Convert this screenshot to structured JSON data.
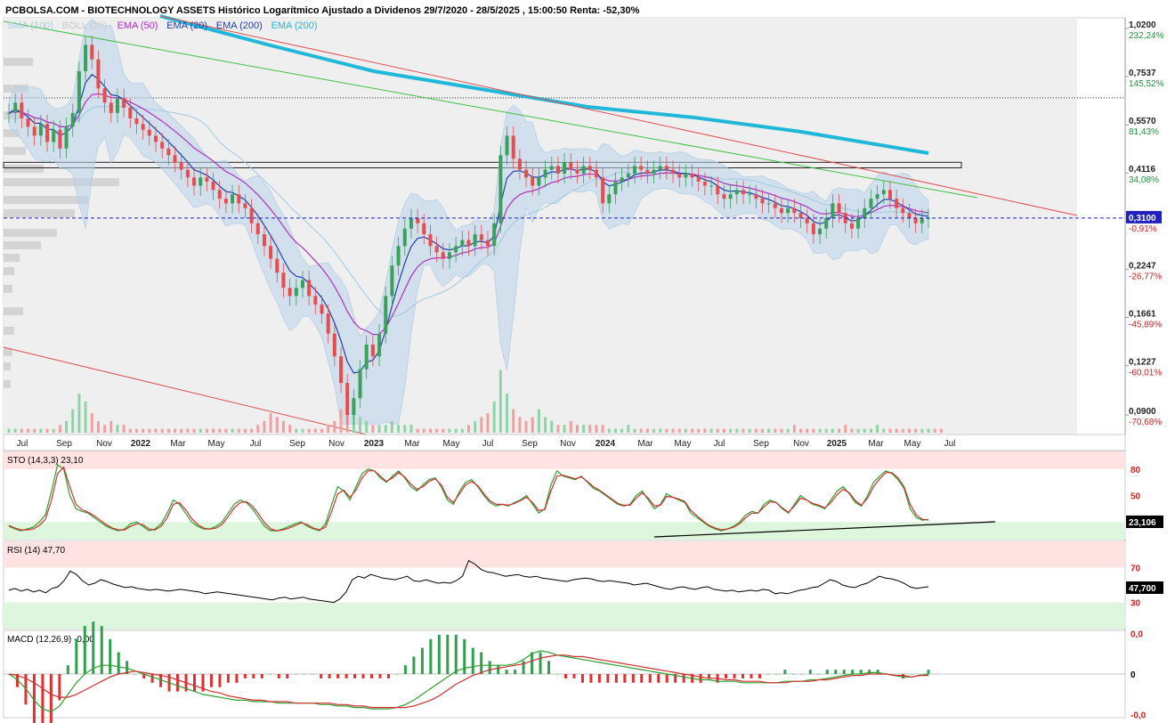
{
  "title": "PCBOLSA.COM - BIOTECHNOLOGY ASSETS Histórico Logarítmico Ajustado a Dividenos 29/7/2020 - 28/5/2025 , 15:00:50 Renta: -52,30%",
  "legend": [
    {
      "label": "SMA (100)",
      "color": "#9ecae1"
    },
    {
      "label": "BOLL (20)",
      "color": "#c8c8c8"
    },
    {
      "label": "EMA (50)",
      "color": "#b030c0"
    },
    {
      "label": "EMA (20)",
      "color": "#2040b0"
    },
    {
      "label": "EMA (200)",
      "color": "#2040b0"
    },
    {
      "label": "EMA (200)",
      "color": "#20b8d8"
    }
  ],
  "colors": {
    "up": "#3aa05a",
    "down": "#e84c4c",
    "band": "#b8d4ea",
    "ema200": "#20b8d8",
    "ema50": "#b030c0",
    "ema20": "#2040b0",
    "sma100": "#9ecae1",
    "trend_red": "#e05050",
    "trend_green": "#40c040",
    "last_price": "#2020c0"
  },
  "chart_data": [
    {
      "type": "line",
      "name": "price",
      "scale": "log",
      "y_ticks": [
        {
          "value": 1.02,
          "label": "1,0200",
          "pct": "232,24%"
        },
        {
          "value": 0.7537,
          "label": "0,7537",
          "pct": "145,52%"
        },
        {
          "value": 0.557,
          "label": "0,5570",
          "pct": "81,43%"
        },
        {
          "value": 0.4116,
          "label": "0,4116",
          "pct": "34,08%"
        },
        {
          "value": 0.31,
          "label": "0,3100",
          "pct": "-0,91%"
        },
        {
          "value": 0.2247,
          "label": "0,2247",
          "pct": "-26,77%"
        },
        {
          "value": 0.1661,
          "label": "0,1661",
          "pct": "-45,89%"
        },
        {
          "value": 0.1227,
          "label": "0,1227",
          "pct": "-60,01%"
        },
        {
          "value": 0.09,
          "label": "0,0900",
          "pct": "-70,68%"
        }
      ],
      "x_ticks": [
        "Jul",
        "Sep",
        "Nov",
        "2022",
        "Mar",
        "May",
        "Jul",
        "Sep",
        "Nov",
        "2023",
        "Mar",
        "May",
        "Jul",
        "Sep",
        "Nov",
        "2024",
        "Mar",
        "May",
        "Jul",
        "Sep",
        "Nov",
        "2025",
        "Mar",
        "May",
        "Jul"
      ],
      "x_tick_years": [
        "2022",
        "2023",
        "2024",
        "2025"
      ],
      "last_price": 0.31,
      "resistance_level": 0.66,
      "range_box": [
        0.425,
        0.44
      ],
      "closes": [
        0.6,
        0.64,
        0.58,
        0.55,
        0.52,
        0.56,
        0.5,
        0.54,
        0.48,
        0.55,
        0.6,
        0.78,
        0.92,
        0.84,
        0.7,
        0.64,
        0.6,
        0.66,
        0.62,
        0.58,
        0.56,
        0.54,
        0.52,
        0.5,
        0.48,
        0.46,
        0.44,
        0.42,
        0.4,
        0.38,
        0.4,
        0.39,
        0.37,
        0.35,
        0.34,
        0.36,
        0.34,
        0.33,
        0.3,
        0.28,
        0.26,
        0.24,
        0.22,
        0.2,
        0.19,
        0.2,
        0.21,
        0.19,
        0.18,
        0.17,
        0.15,
        0.13,
        0.11,
        0.09,
        0.1,
        0.12,
        0.14,
        0.13,
        0.15,
        0.19,
        0.23,
        0.26,
        0.29,
        0.31,
        0.3,
        0.28,
        0.26,
        0.25,
        0.24,
        0.25,
        0.26,
        0.27,
        0.26,
        0.28,
        0.27,
        0.26,
        0.3,
        0.46,
        0.52,
        0.45,
        0.42,
        0.4,
        0.38,
        0.4,
        0.42,
        0.43,
        0.41,
        0.44,
        0.42,
        0.41,
        0.43,
        0.42,
        0.4,
        0.34,
        0.36,
        0.39,
        0.4,
        0.41,
        0.43,
        0.42,
        0.41,
        0.42,
        0.43,
        0.42,
        0.41,
        0.4,
        0.41,
        0.4,
        0.39,
        0.38,
        0.38,
        0.36,
        0.35,
        0.36,
        0.37,
        0.36,
        0.36,
        0.35,
        0.34,
        0.34,
        0.33,
        0.32,
        0.33,
        0.32,
        0.31,
        0.3,
        0.28,
        0.29,
        0.31,
        0.34,
        0.32,
        0.3,
        0.29,
        0.31,
        0.33,
        0.35,
        0.36,
        0.37,
        0.35,
        0.33,
        0.32,
        0.31,
        0.3,
        0.31,
        0.31
      ],
      "volumes": [
        0.1,
        0.1,
        0.1,
        0.1,
        0.1,
        0.1,
        0.1,
        0.1,
        0.2,
        0.3,
        0.6,
        1.0,
        0.8,
        0.5,
        0.3,
        0.2,
        0.3,
        0.2,
        0.2,
        0.1,
        0.1,
        0.1,
        0.1,
        0.1,
        0.1,
        0.1,
        0.1,
        0.1,
        0.1,
        0.1,
        0.1,
        0.1,
        0.1,
        0.1,
        0.1,
        0.1,
        0.1,
        0.1,
        0.1,
        0.2,
        0.3,
        0.5,
        0.4,
        0.3,
        0.2,
        0.1,
        0.1,
        0.1,
        0.1,
        0.1,
        0.2,
        0.3,
        0.6,
        0.9,
        0.6,
        0.4,
        0.3,
        0.2,
        0.2,
        0.2,
        0.3,
        0.2,
        0.2,
        0.2,
        0.1,
        0.1,
        0.1,
        0.1,
        0.1,
        0.1,
        0.1,
        0.1,
        0.2,
        0.3,
        0.4,
        0.5,
        0.8,
        1.6,
        1.0,
        0.6,
        0.4,
        0.3,
        0.4,
        0.6,
        0.4,
        0.3,
        0.2,
        0.2,
        0.3,
        0.2,
        0.2,
        0.2,
        0.2,
        0.2,
        0.1,
        0.1,
        0.1,
        0.2,
        0.1,
        0.1,
        0.1,
        0.1,
        0.1,
        0.1,
        0.1,
        0.1,
        0.1,
        0.1,
        0.1,
        0.1,
        0.1,
        0.1,
        0.1,
        0.1,
        0.1,
        0.1,
        0.1,
        0.1,
        0.1,
        0.1,
        0.1,
        0.1,
        0.1,
        0.2,
        0.1,
        0.1,
        0.1,
        0.1,
        0.1,
        0.1,
        0.1,
        0.2,
        0.1,
        0.1,
        0.1,
        0.1,
        0.2,
        0.1,
        0.1,
        0.1,
        0.1,
        0.1,
        0.1,
        0.1,
        0.1,
        0.1,
        0.1
      ]
    },
    {
      "type": "line",
      "name": "STO (14,3,3)",
      "label": "STO (14,3,3)",
      "value_label": "23,10",
      "last_badge": "23,106",
      "ylim": [
        0,
        100
      ],
      "y_ticks": [
        {
          "value": 80,
          "label": "80"
        },
        {
          "value": 50,
          "label": "50"
        }
      ],
      "overbought": 80,
      "oversold": 20,
      "k": [
        15,
        12,
        10,
        12,
        14,
        20,
        28,
        55,
        85,
        80,
        50,
        35,
        32,
        30,
        25,
        20,
        15,
        12,
        10,
        12,
        18,
        20,
        15,
        10,
        12,
        18,
        30,
        45,
        40,
        30,
        20,
        15,
        12,
        12,
        15,
        20,
        30,
        40,
        45,
        42,
        35,
        25,
        15,
        10,
        10,
        12,
        15,
        18,
        20,
        15,
        12,
        10,
        18,
        40,
        60,
        55,
        45,
        60,
        75,
        80,
        78,
        70,
        65,
        72,
        78,
        70,
        60,
        55,
        62,
        68,
        70,
        60,
        45,
        40,
        55,
        65,
        68,
        60,
        50,
        42,
        38,
        40,
        38,
        42,
        45,
        50,
        40,
        30,
        35,
        62,
        78,
        72,
        70,
        68,
        72,
        65,
        58,
        55,
        50,
        45,
        40,
        38,
        40,
        50,
        55,
        45,
        35,
        40,
        52,
        48,
        45,
        42,
        30,
        25,
        20,
        15,
        12,
        10,
        12,
        15,
        20,
        28,
        32,
        30,
        40,
        45,
        42,
        35,
        30,
        40,
        50,
        45,
        40,
        38,
        35,
        45,
        55,
        60,
        52,
        42,
        38,
        50,
        65,
        72,
        78,
        75,
        68,
        58,
        35,
        25,
        22,
        23
      ],
      "d": [
        16,
        13,
        11,
        11,
        12,
        16,
        23,
        45,
        75,
        82,
        60,
        40,
        34,
        31,
        27,
        22,
        17,
        13,
        11,
        11,
        15,
        18,
        17,
        12,
        11,
        15,
        25,
        40,
        42,
        34,
        24,
        17,
        13,
        12,
        13,
        17,
        26,
        36,
        42,
        43,
        38,
        29,
        19,
        12,
        10,
        11,
        13,
        16,
        19,
        17,
        13,
        11,
        14,
        32,
        52,
        56,
        48,
        56,
        70,
        78,
        78,
        72,
        66,
        70,
        76,
        71,
        63,
        57,
        60,
        66,
        69,
        62,
        48,
        42,
        52,
        62,
        66,
        61,
        52,
        44,
        40,
        40,
        39,
        41,
        44,
        48,
        42,
        33,
        34,
        55,
        72,
        73,
        71,
        69,
        71,
        66,
        60,
        56,
        51,
        46,
        41,
        39,
        39,
        47,
        53,
        47,
        38,
        39,
        49,
        48,
        46,
        43,
        33,
        27,
        21,
        16,
        13,
        11,
        12,
        14,
        18,
        25,
        30,
        30,
        37,
        43,
        42,
        36,
        31,
        38,
        47,
        45,
        41,
        39,
        36,
        42,
        51,
        57,
        53,
        44,
        39,
        47,
        60,
        69,
        76,
        76,
        70,
        60,
        40,
        28,
        23,
        22
      ]
    },
    {
      "type": "line",
      "name": "RSI (14)",
      "label": "RSI (14)",
      "value_label": "47,70",
      "last_badge": "47,700",
      "ylim": [
        0,
        100
      ],
      "y_ticks": [
        {
          "value": 70,
          "label": "70"
        },
        {
          "value": 30,
          "label": "30"
        }
      ],
      "overbought": 70,
      "oversold": 30,
      "values": [
        44,
        46,
        43,
        45,
        42,
        44,
        41,
        46,
        48,
        55,
        66,
        62,
        55,
        50,
        52,
        56,
        54,
        51,
        49,
        47,
        48,
        46,
        45,
        44,
        45,
        44,
        43,
        44,
        45,
        44,
        43,
        42,
        40,
        41,
        42,
        41,
        40,
        39,
        38,
        37,
        36,
        35,
        34,
        33,
        35,
        36,
        34,
        35,
        36,
        34,
        33,
        32,
        31,
        30,
        34,
        42,
        56,
        60,
        58,
        62,
        60,
        58,
        57,
        56,
        58,
        60,
        55,
        54,
        56,
        54,
        52,
        53,
        52,
        55,
        60,
        78,
        74,
        68,
        65,
        64,
        62,
        60,
        61,
        62,
        60,
        59,
        60,
        58,
        57,
        56,
        55,
        54,
        56,
        57,
        58,
        57,
        55,
        54,
        55,
        54,
        53,
        52,
        50,
        51,
        52,
        50,
        48,
        46,
        45,
        47,
        48,
        46,
        45,
        47,
        48,
        45,
        44,
        43,
        44,
        42,
        43,
        44,
        43,
        45,
        44,
        40,
        41,
        40,
        42,
        44,
        45,
        47,
        48,
        52,
        56,
        54,
        50,
        48,
        47,
        50,
        52,
        56,
        60,
        58,
        57,
        55,
        52,
        48,
        46,
        47,
        48
      ]
    },
    {
      "type": "line",
      "name": "MACD (12,26,9)",
      "label": "MACD (12,26,9)",
      "value_label": "-0,00",
      "ylim": [
        -0.03,
        0.03
      ],
      "y_ticks": [
        {
          "value": 0.028,
          "label": "0,0",
          "color": "#d02020"
        },
        {
          "value": 0,
          "label": "0",
          "color": "#000"
        },
        {
          "value": -0.028,
          "label": "-0,0",
          "color": "#d02020"
        }
      ],
      "macd": [
        0.0,
        -0.004,
        -0.01,
        -0.018,
        -0.024,
        -0.026,
        -0.022,
        -0.014,
        -0.006,
        0.0,
        0.004,
        0.006,
        0.006,
        0.005,
        0.004,
        0.002,
        0.0,
        -0.002,
        -0.004,
        -0.006,
        -0.008,
        -0.01,
        -0.012,
        -0.014,
        -0.015,
        -0.016,
        -0.017,
        -0.018,
        -0.018,
        -0.019,
        -0.019,
        -0.019,
        -0.02,
        -0.02,
        -0.02,
        -0.02,
        -0.02,
        -0.021,
        -0.021,
        -0.022,
        -0.022,
        -0.023,
        -0.023,
        -0.024,
        -0.024,
        -0.024,
        -0.023,
        -0.021,
        -0.018,
        -0.014,
        -0.01,
        -0.006,
        -0.002,
        0.002,
        0.004,
        0.005,
        0.006,
        0.006,
        0.006,
        0.006,
        0.007,
        0.01,
        0.014,
        0.016,
        0.015,
        0.013,
        0.012,
        0.011,
        0.01,
        0.009,
        0.008,
        0.007,
        0.006,
        0.005,
        0.004,
        0.003,
        0.002,
        0.001,
        0.0,
        -0.001,
        -0.002,
        -0.003,
        -0.004,
        -0.004,
        -0.005,
        -0.005,
        -0.005,
        -0.006,
        -0.006,
        -0.006,
        -0.006,
        -0.006,
        -0.005,
        -0.005,
        -0.005,
        -0.004,
        -0.004,
        -0.003,
        -0.002,
        -0.001,
        0.0,
        0.0,
        0.001,
        0.001,
        0.0,
        -0.001,
        -0.002,
        -0.002,
        -0.001,
        0.0
      ],
      "signal": [
        0.0,
        -0.001,
        -0.003,
        -0.006,
        -0.01,
        -0.014,
        -0.016,
        -0.016,
        -0.014,
        -0.011,
        -0.008,
        -0.005,
        -0.002,
        0.0,
        0.001,
        0.002,
        0.001,
        0.0,
        -0.001,
        -0.002,
        -0.004,
        -0.006,
        -0.008,
        -0.01,
        -0.012,
        -0.013,
        -0.015,
        -0.016,
        -0.017,
        -0.018,
        -0.018,
        -0.019,
        -0.019,
        -0.019,
        -0.02,
        -0.02,
        -0.02,
        -0.02,
        -0.02,
        -0.021,
        -0.021,
        -0.022,
        -0.022,
        -0.023,
        -0.023,
        -0.023,
        -0.023,
        -0.023,
        -0.022,
        -0.02,
        -0.018,
        -0.015,
        -0.011,
        -0.007,
        -0.004,
        -0.001,
        0.001,
        0.003,
        0.004,
        0.005,
        0.006,
        0.007,
        0.009,
        0.011,
        0.012,
        0.013,
        0.013,
        0.012,
        0.012,
        0.011,
        0.01,
        0.009,
        0.008,
        0.007,
        0.006,
        0.005,
        0.004,
        0.003,
        0.002,
        0.001,
        0.0,
        -0.001,
        -0.002,
        -0.003,
        -0.003,
        -0.004,
        -0.004,
        -0.005,
        -0.005,
        -0.005,
        -0.006,
        -0.006,
        -0.006,
        -0.005,
        -0.005,
        -0.005,
        -0.004,
        -0.004,
        -0.003,
        -0.002,
        -0.001,
        -0.001,
        0.0,
        0.0,
        0.0,
        -0.001,
        -0.001,
        -0.002,
        -0.001,
        -0.001
      ],
      "hist_scale": 1
    }
  ]
}
